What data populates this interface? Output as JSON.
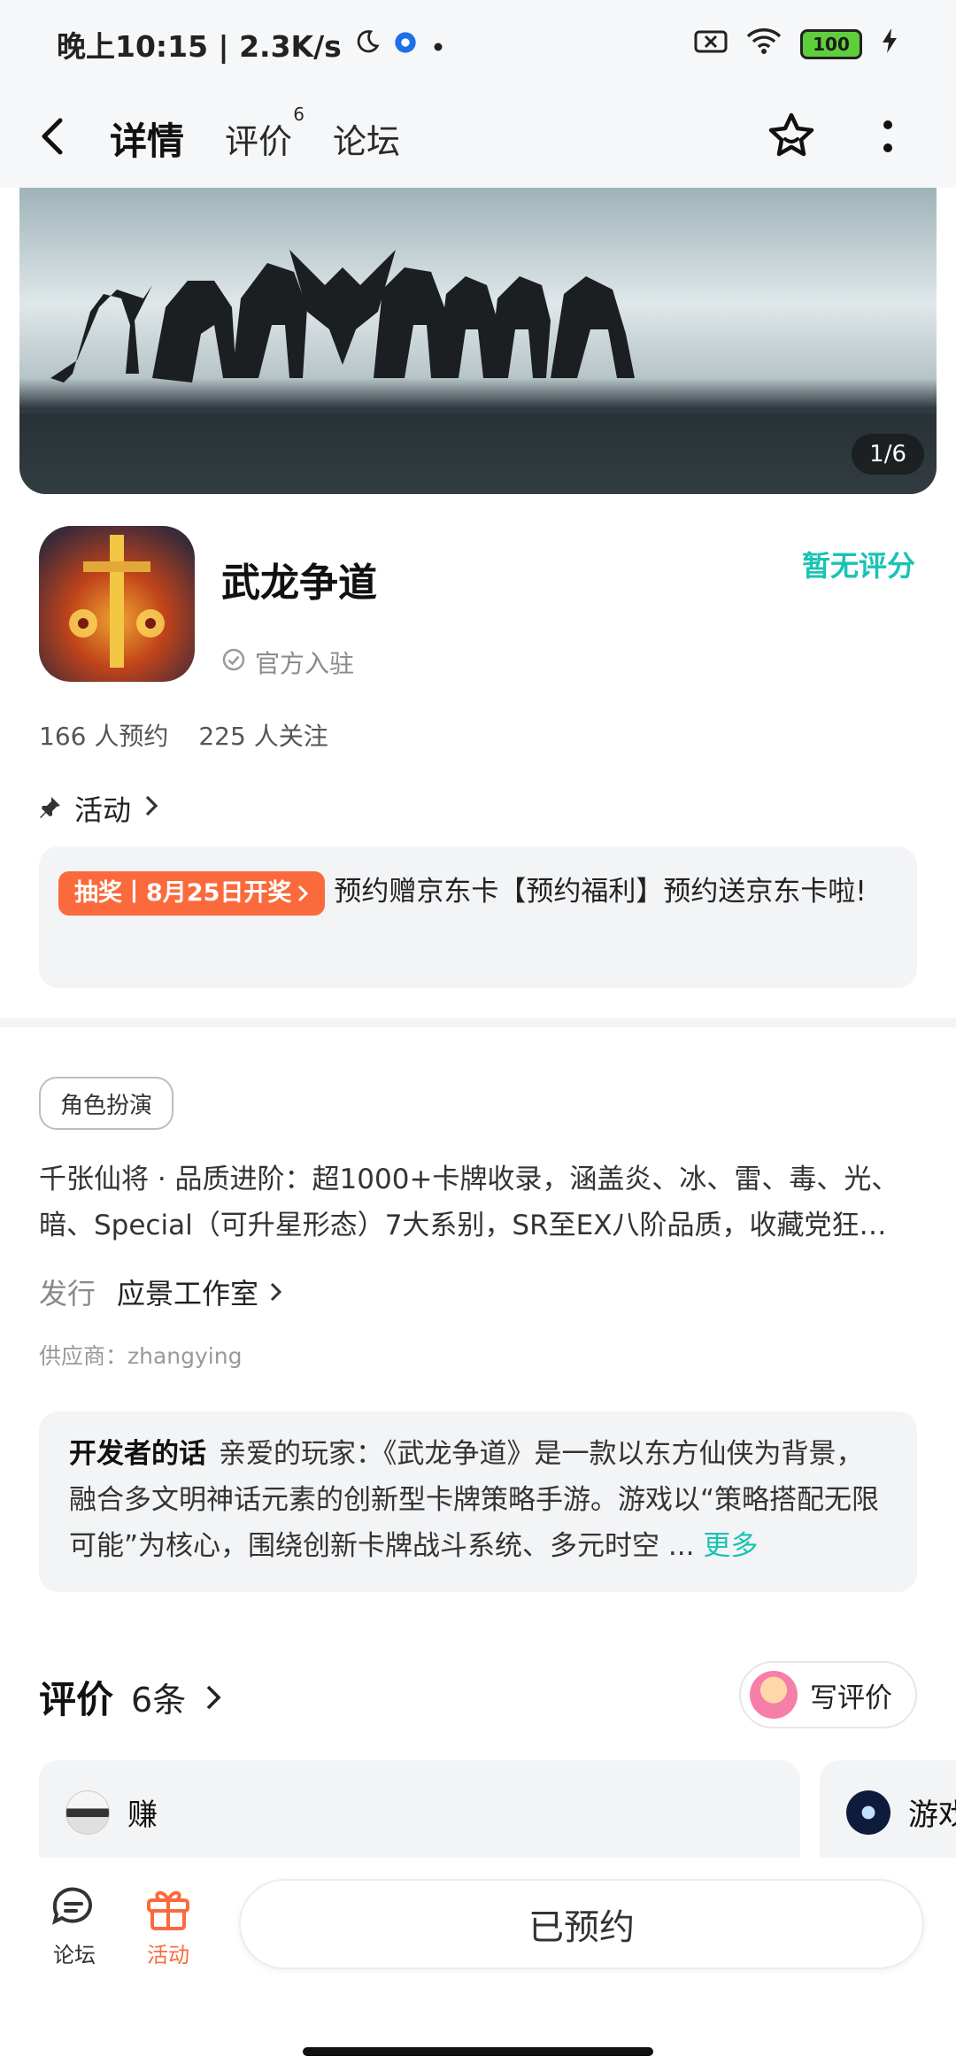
{
  "status_bar": {
    "time_speed": "晚上10:15 | 2.3K/s",
    "battery": "100"
  },
  "nav": {
    "tabs": [
      {
        "label": "详情",
        "badge": ""
      },
      {
        "label": "评价",
        "badge": "6"
      },
      {
        "label": "论坛",
        "badge": ""
      }
    ]
  },
  "banner": {
    "counter": "1/6"
  },
  "game": {
    "title": "武龙争道",
    "official": "官方入驻",
    "rating": "暂无评分",
    "reservations": "166 人预约",
    "followers": "225 人关注"
  },
  "activity": {
    "heading": "活动",
    "badge": "抽奖丨8月25日开奖",
    "text": "预约赠京东卡【预约福利】预约送京东卡啦!"
  },
  "details": {
    "genre_tag": "角色扮演",
    "description": "千张仙将 · 品质进阶：超1000+卡牌收录，涵盖炎、冰、雷、毒、光、暗、Special（可升星形态）7大系别，SR至EX八阶品质，收藏党狂…",
    "publisher_label": "发行",
    "publisher": "应景工作室",
    "supplier": "供应商：zhangying"
  },
  "developer": {
    "label": "开发者的话",
    "text": "亲爱的玩家：《武龙争道》是一款以东方仙侠为背景，融合多文明神话元素的创新型卡牌策略手游。游戏以“策略搭配无限可能”为核心，围绕创新卡牌战斗系统、多元时空 ...",
    "more": "更多"
  },
  "reviews": {
    "title": "评价",
    "count": "6条",
    "write": "写评价",
    "items": [
      {
        "name": "赚"
      },
      {
        "name": "游戏"
      }
    ]
  },
  "bottom": {
    "forum": "论坛",
    "activity": "活动",
    "reserved": "已预约"
  },
  "colors": {
    "accent": "#19c3b3",
    "orange": "#fa6a3c"
  }
}
